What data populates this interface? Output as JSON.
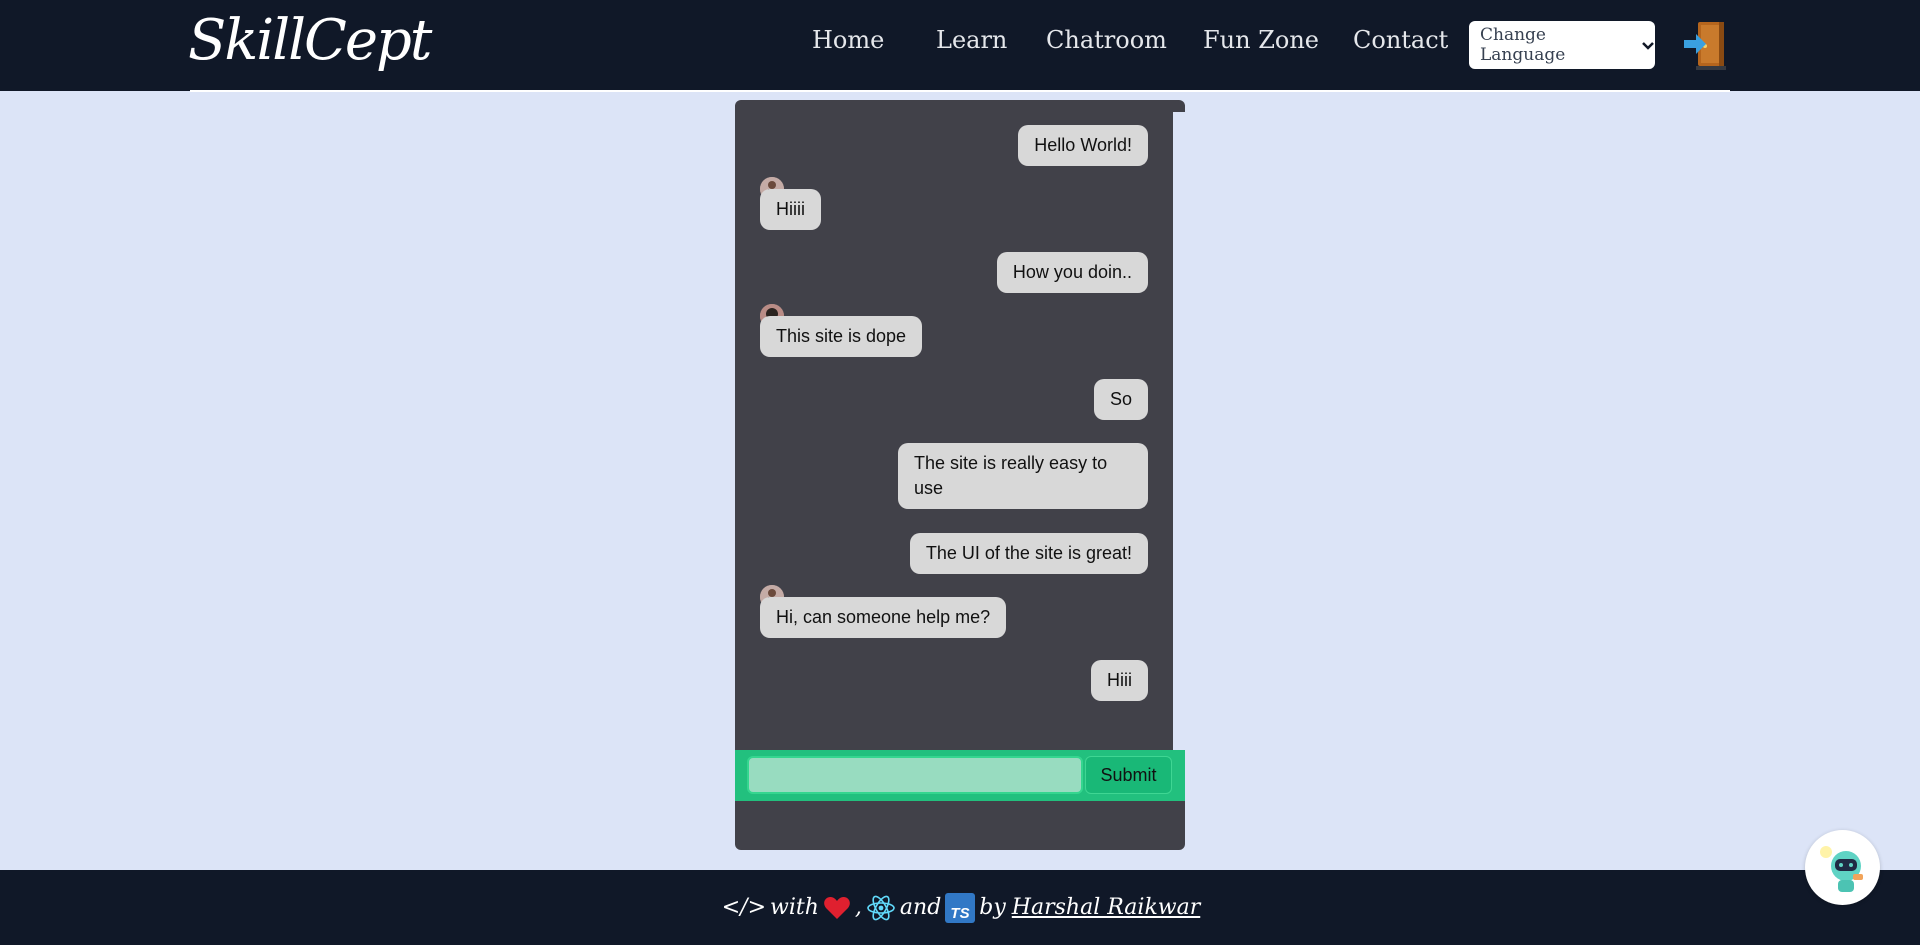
{
  "header": {
    "logo": "SkillCept",
    "nav": [
      "Home",
      "Learn",
      "Chatroom",
      "Fun Zone",
      "Contact"
    ],
    "language_select": "Change Language"
  },
  "chat": {
    "messages": [
      {
        "side": "right",
        "text": "Hello World!"
      },
      {
        "side": "left",
        "text": "Hiiii"
      },
      {
        "side": "right",
        "text": "How you doin.."
      },
      {
        "side": "left",
        "text": "This site is dope"
      },
      {
        "side": "right",
        "text": "So"
      },
      {
        "side": "right",
        "text": "The site is really easy to use"
      },
      {
        "side": "right",
        "text": "The UI of the site is great!"
      },
      {
        "side": "left",
        "text": "Hi, can someone help me?"
      },
      {
        "side": "right",
        "text": "Hiii"
      }
    ],
    "input_value": "",
    "submit_label": "Submit"
  },
  "footer": {
    "code_text": "</>",
    "with_text": "with",
    "and_text": "and",
    "by_text": "by",
    "author": "Harshal Raikwar",
    "icons": [
      "heart-icon",
      "react-icon",
      "typescript-icon"
    ]
  },
  "colors": {
    "navbar": "#101828",
    "page_bg": "#dce4f7",
    "chat_bg": "#414149",
    "bubble": "#d8d8d8",
    "input_bar": "#22c07e"
  }
}
